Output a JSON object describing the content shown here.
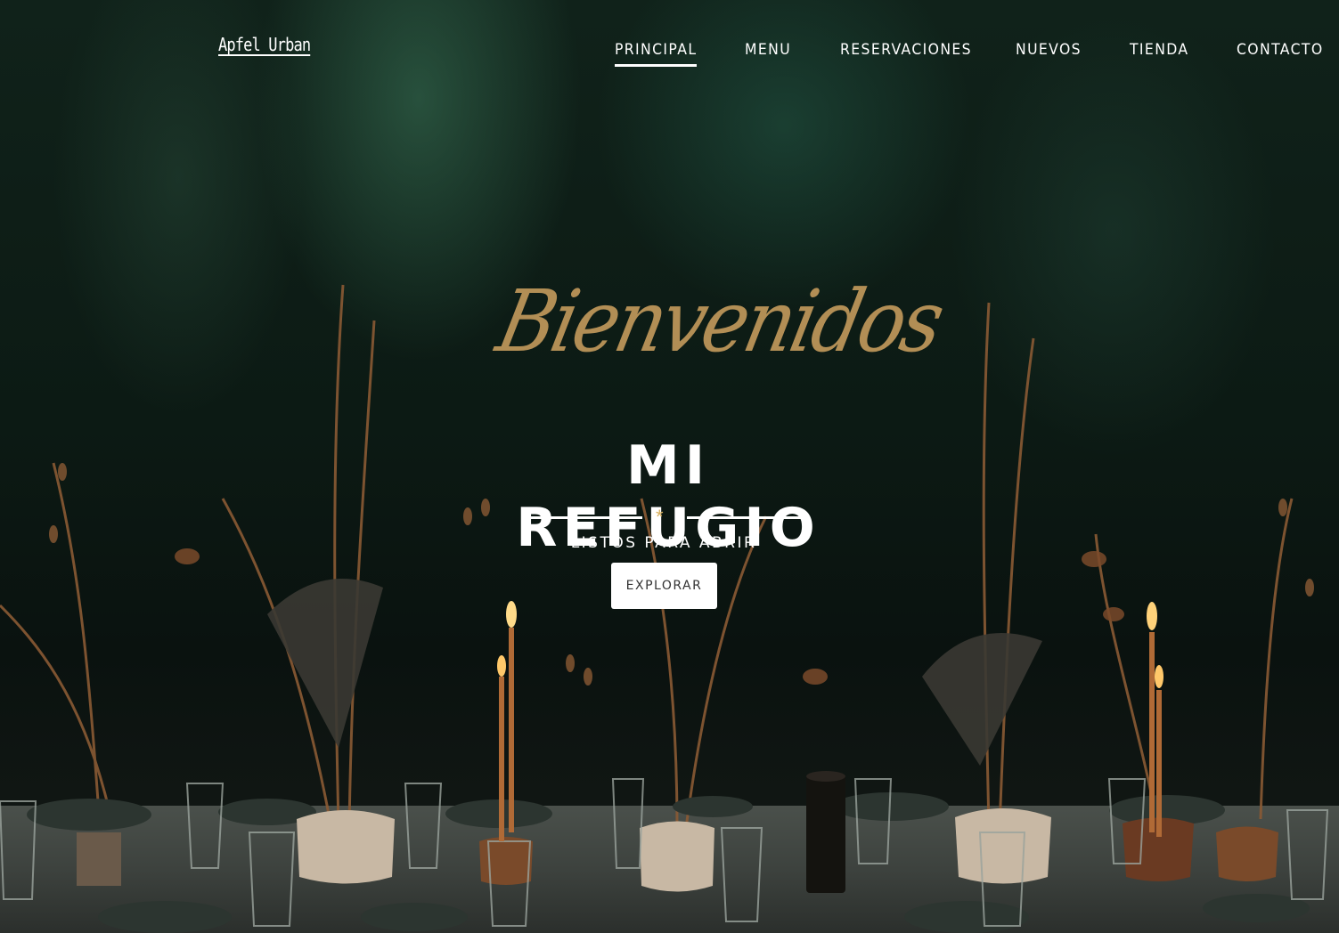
{
  "brand": {
    "name": "Apfel Urban"
  },
  "nav": {
    "items": [
      {
        "label": "PRINCIPAL",
        "active": true
      },
      {
        "label": "MENU"
      },
      {
        "label": "RESERVACIONES"
      },
      {
        "label": "NUEVOS"
      },
      {
        "label": "TIENDA"
      },
      {
        "label": "CONTACTO"
      }
    ]
  },
  "hero": {
    "script_heading": "Bienvenidos",
    "title": "MI REFUGIO",
    "divider_symbol": "*",
    "subtitle": "LISTOS PARA ABRIR",
    "cta_label": "EXPLORAR"
  },
  "colors": {
    "accent_gold": "#b28e55",
    "text": "#ffffff",
    "button_bg": "#ffffff",
    "button_text": "#333333"
  }
}
